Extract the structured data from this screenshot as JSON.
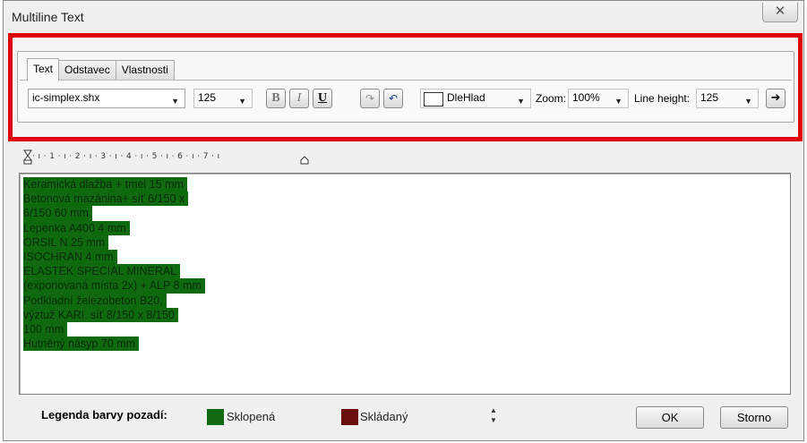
{
  "window": {
    "title": "Multiline Text",
    "close_glyph": "✕"
  },
  "tabs": [
    {
      "label": "Text",
      "active": true
    },
    {
      "label": "Odstavec",
      "active": false
    },
    {
      "label": "Vlastnosti",
      "active": false
    }
  ],
  "toolbar": {
    "font": "ic-simplex.shx",
    "size": "125",
    "bold": "B",
    "italic": "I",
    "underline": "U",
    "color_value": "DleHlad",
    "zoom_label": "Zoom:",
    "zoom_value": "100%",
    "line_height_label": "Line height:",
    "line_height_value": "125"
  },
  "ruler": "· ı · 1 · ı · 2 · ı · 3 · ı · 4 · ı · 5 · ı · 6 · ı · 7 · ı",
  "text_lines": [
    "Keramická dlažba + tmel 15 mm",
    "Betonová mazánina+ síť 6/150 x",
    "6/150 60 mm",
    "Lepenka A400 4 mm",
    "ORSIL N 25 mm",
    "ISOCHRAN 4 mm",
    "ELASTEK SPECIAL MINERAL",
    "(exponovaná místa 2x) + ALP 8 mm",
    "Podkladní železobeton B20,",
    "výztuž KARI. síť 8/150 x 8/150",
    "100 mm",
    "Hutněný násyp 70 mm"
  ],
  "legend": {
    "title": "Legenda barvy pozadí:",
    "items": [
      {
        "label": "Sklopená",
        "color": "#0f6a0f"
      },
      {
        "label": "Skládaný",
        "color": "#6b0e0e"
      }
    ]
  },
  "buttons": {
    "ok": "OK",
    "cancel": "Storno"
  },
  "colors": {
    "highlight_frame": "#e00000",
    "text_background": "#0f6a0f"
  },
  "icons": {
    "close": "close-icon",
    "dropdown": "chevron-down-icon",
    "redo": "redo-icon",
    "undo": "undo-icon",
    "arrow": "arrow-down-icon",
    "spin": "spin-icon"
  }
}
